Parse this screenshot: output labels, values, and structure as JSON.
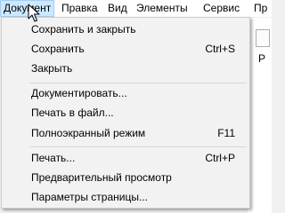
{
  "menubar": {
    "items": [
      {
        "label": "Документ"
      },
      {
        "label": "Правка"
      },
      {
        "label": "Вид"
      },
      {
        "label": "Элементы"
      },
      {
        "label": "Сервис"
      },
      {
        "label": "Пр"
      }
    ]
  },
  "background": {
    "partial_text": "P"
  },
  "dropdown": {
    "items": [
      {
        "label": "Сохранить и закрыть",
        "shortcut": ""
      },
      {
        "label": "Сохранить",
        "shortcut": "Ctrl+S"
      },
      {
        "label": "Закрыть",
        "shortcut": ""
      },
      {
        "label": "Документировать...",
        "shortcut": ""
      },
      {
        "label": "Печать в файл...",
        "shortcut": ""
      },
      {
        "label": "Полноэкранный режим",
        "shortcut": "F11"
      },
      {
        "label": "Печать...",
        "shortcut": "Ctrl+P"
      },
      {
        "label": "Предварительный просмотр",
        "shortcut": ""
      },
      {
        "label": "Параметры страницы...",
        "shortcut": ""
      }
    ]
  },
  "colors": {
    "menubar_bg": "#ffffff",
    "active_item_bg": "#cce8ff",
    "active_item_border": "#99d1ff",
    "dropdown_bg": "#f2f2f2",
    "separator": "#d7d7d7"
  }
}
